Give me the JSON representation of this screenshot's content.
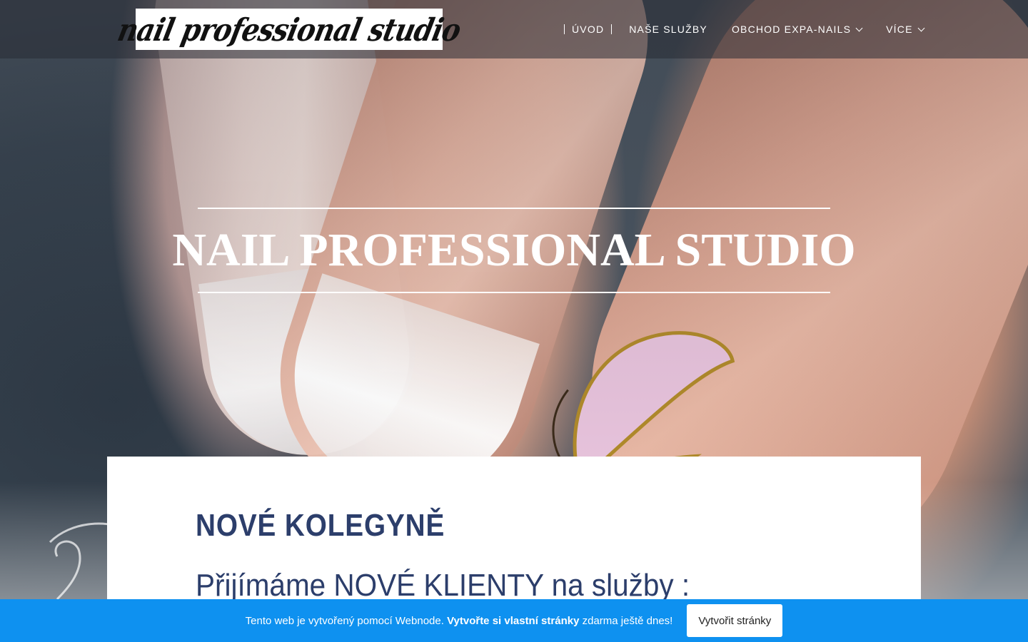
{
  "brand": {
    "logo_text": "nail professional studio"
  },
  "nav": {
    "items": [
      {
        "label": "ÚVOD",
        "active": true,
        "has_dropdown": false
      },
      {
        "label": "NAŠE SLUŽBY",
        "active": false,
        "has_dropdown": false
      },
      {
        "label": "OBCHOD EXPA-NAILS",
        "active": false,
        "has_dropdown": true
      },
      {
        "label": "VÍCE",
        "active": false,
        "has_dropdown": true
      }
    ],
    "dropdown_icon": "chevron-down-icon"
  },
  "hero": {
    "title": "NAIL PROFESSIONAL STUDIO"
  },
  "content": {
    "heading": "NOVÉ KOLEGYNĚ",
    "text": "Přijímáme NOVÉ KLIENTY na služby :"
  },
  "webnode_bar": {
    "text_before": "Tento web je vytvořený pomocí Webnode. ",
    "text_bold": "Vytvořte si vlastní stránky",
    "text_after": " zdarma ještě dnes!",
    "button_label": "Vytvořit stránky"
  },
  "colors": {
    "heading_blue": "#2c3e6b",
    "webnode_blue": "#0e91f0",
    "header_overlay": "#282c34"
  }
}
